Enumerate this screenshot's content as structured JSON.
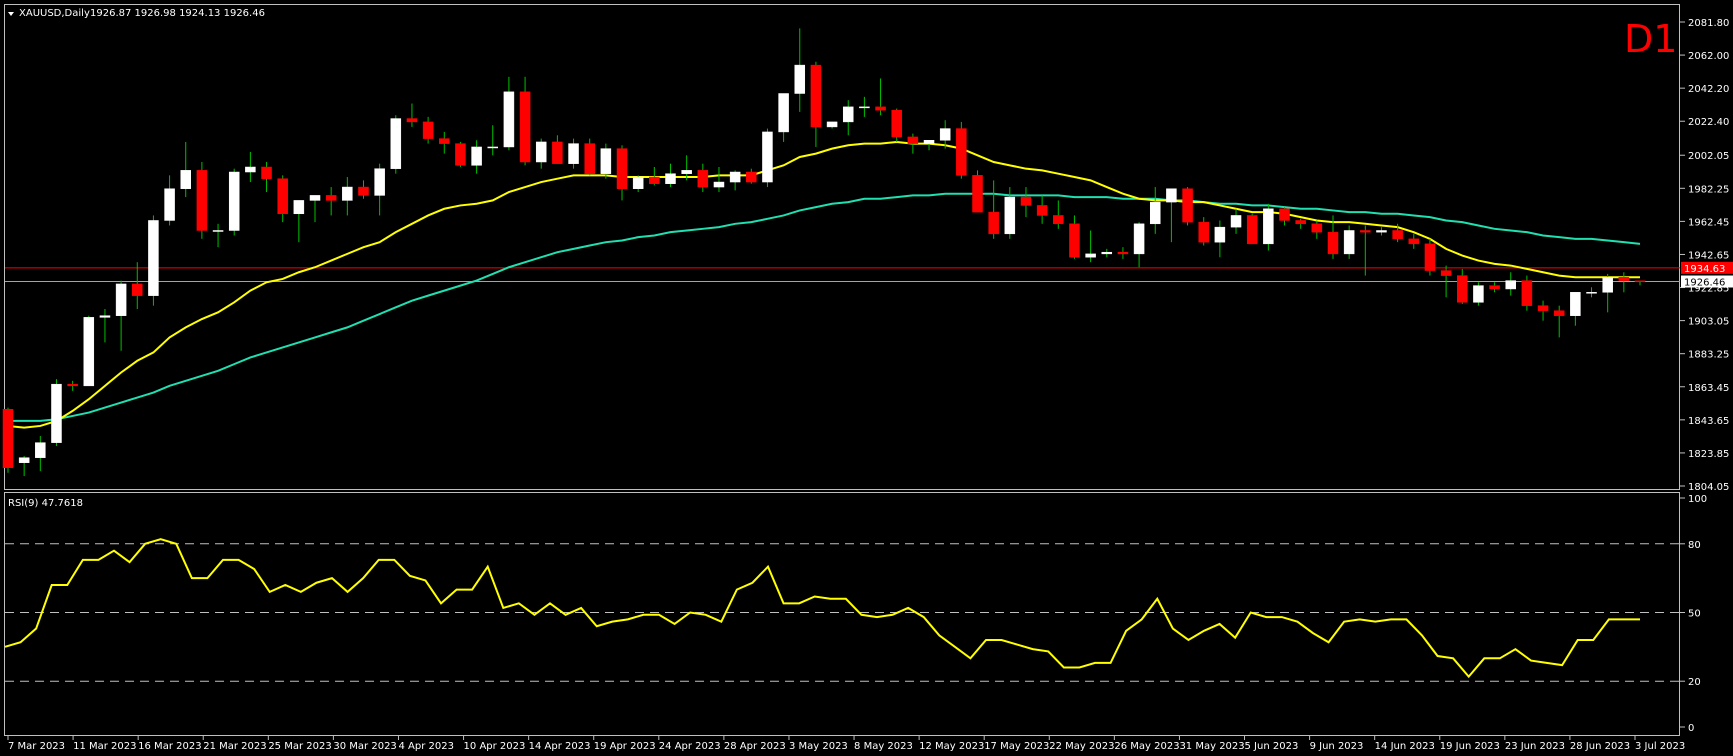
{
  "header": {
    "menu_icon": "triangle-down-icon",
    "symbol": "XAUUSD,Daily",
    "ohlc": "1926.87 1926.98 1924.13 1926.46",
    "timeframe_badge": "D1"
  },
  "rsi_panel": {
    "label": "RSI(9) 47.7618"
  },
  "price_tags": {
    "red_line_label": "1934.63",
    "current_label": "1926.46"
  },
  "colors": {
    "background": "#000000",
    "grid_border": "#c0c0c0",
    "bull_candle": "#ffffff",
    "bear_candle": "#ff0000",
    "wick": "#00c000",
    "ma_fast": "#ffff00",
    "ma_slow": "#20e0b0",
    "rsi_line": "#ffff00",
    "horizontal_line": "#ff0000",
    "badge_text": "#ff0000"
  },
  "chart_data": [
    {
      "type": "candlestick",
      "title": "XAUUSD,Daily",
      "y_ticks": [
        "2081.80",
        "2062.00",
        "2042.20",
        "2022.40",
        "2002.05",
        "1982.25",
        "1962.45",
        "1942.65",
        "1922.85",
        "1903.05",
        "1883.25",
        "1863.45",
        "1843.65",
        "1823.85",
        "1804.05"
      ],
      "ylim": [
        1804.05,
        2081.8
      ],
      "x_ticks": [
        "7 Mar 2023",
        "11 Mar 2023",
        "16 Mar 2023",
        "21 Mar 2023",
        "25 Mar 2023",
        "30 Mar 2023",
        "4 Apr 2023",
        "10 Apr 2023",
        "14 Apr 2023",
        "19 Apr 2023",
        "24 Apr 2023",
        "28 Apr 2023",
        "3 May 2023",
        "8 May 2023",
        "12 May 2023",
        "17 May 2023",
        "22 May 2023",
        "26 May 2023",
        "31 May 2023",
        "5 Jun 2023",
        "9 Jun 2023",
        "14 Jun 2023",
        "19 Jun 2023",
        "23 Jun 2023",
        "28 Jun 2023",
        "3 Jul 2023"
      ],
      "horizontal_line_value": 1934.63,
      "current_price": 1926.46,
      "candles": [
        {
          "o": 1850,
          "h": 1851,
          "l": 1812,
          "c": 1815
        },
        {
          "o": 1818,
          "h": 1822,
          "l": 1810,
          "c": 1821
        },
        {
          "o": 1821,
          "h": 1834,
          "l": 1813,
          "c": 1830
        },
        {
          "o": 1830,
          "h": 1868,
          "l": 1828,
          "c": 1865
        },
        {
          "o": 1865,
          "h": 1867,
          "l": 1861,
          "c": 1864
        },
        {
          "o": 1864,
          "h": 1906,
          "l": 1864,
          "c": 1905
        },
        {
          "o": 1905,
          "h": 1910,
          "l": 1890,
          "c": 1906
        },
        {
          "o": 1906,
          "h": 1927,
          "l": 1885,
          "c": 1925
        },
        {
          "o": 1925,
          "h": 1938,
          "l": 1910,
          "c": 1918
        },
        {
          "o": 1918,
          "h": 1966,
          "l": 1912,
          "c": 1963
        },
        {
          "o": 1963,
          "h": 1990,
          "l": 1960,
          "c": 1982
        },
        {
          "o": 1982,
          "h": 2010,
          "l": 1977,
          "c": 1993
        },
        {
          "o": 1993,
          "h": 1998,
          "l": 1952,
          "c": 1957
        },
        {
          "o": 1957,
          "h": 1961,
          "l": 1947,
          "c": 1957
        },
        {
          "o": 1957,
          "h": 1994,
          "l": 1954,
          "c": 1992
        },
        {
          "o": 1992,
          "h": 2004,
          "l": 1986,
          "c": 1995
        },
        {
          "o": 1995,
          "h": 1998,
          "l": 1980,
          "c": 1988
        },
        {
          "o": 1988,
          "h": 1990,
          "l": 1962,
          "c": 1967
        },
        {
          "o": 1967,
          "h": 1975,
          "l": 1950,
          "c": 1975
        },
        {
          "o": 1975,
          "h": 1978,
          "l": 1962,
          "c": 1978
        },
        {
          "o": 1978,
          "h": 1983,
          "l": 1966,
          "c": 1975
        },
        {
          "o": 1975,
          "h": 1989,
          "l": 1966,
          "c": 1983
        },
        {
          "o": 1983,
          "h": 1987,
          "l": 1976,
          "c": 1978
        },
        {
          "o": 1978,
          "h": 1997,
          "l": 1966,
          "c": 1994
        },
        {
          "o": 1994,
          "h": 2026,
          "l": 1991,
          "c": 2024
        },
        {
          "o": 2024,
          "h": 2033,
          "l": 2019,
          "c": 2022
        },
        {
          "o": 2022,
          "h": 2025,
          "l": 2009,
          "c": 2012
        },
        {
          "o": 2012,
          "h": 2016,
          "l": 2003,
          "c": 2009
        },
        {
          "o": 2009,
          "h": 2010,
          "l": 1995,
          "c": 1996
        },
        {
          "o": 1996,
          "h": 2011,
          "l": 1991,
          "c": 2007
        },
        {
          "o": 2007,
          "h": 2020,
          "l": 2002,
          "c": 2007
        },
        {
          "o": 2007,
          "h": 2049,
          "l": 2005,
          "c": 2040
        },
        {
          "o": 2040,
          "h": 2049,
          "l": 1996,
          "c": 1998
        },
        {
          "o": 1998,
          "h": 2012,
          "l": 1994,
          "c": 2010
        },
        {
          "o": 2010,
          "h": 2014,
          "l": 1997,
          "c": 1997
        },
        {
          "o": 1997,
          "h": 2012,
          "l": 1994,
          "c": 2009
        },
        {
          "o": 2009,
          "h": 2012,
          "l": 1990,
          "c": 1991
        },
        {
          "o": 1991,
          "h": 2009,
          "l": 1988,
          "c": 2006
        },
        {
          "o": 2006,
          "h": 2008,
          "l": 1975,
          "c": 1982
        },
        {
          "o": 1982,
          "h": 1990,
          "l": 1980,
          "c": 1989
        },
        {
          "o": 1989,
          "h": 1995,
          "l": 1984,
          "c": 1985
        },
        {
          "o": 1985,
          "h": 1997,
          "l": 1983,
          "c": 1991
        },
        {
          "o": 1991,
          "h": 2002,
          "l": 1987,
          "c": 1993
        },
        {
          "o": 1993,
          "h": 1997,
          "l": 1980,
          "c": 1983
        },
        {
          "o": 1983,
          "h": 1995,
          "l": 1980,
          "c": 1986
        },
        {
          "o": 1986,
          "h": 1993,
          "l": 1981,
          "c": 1992
        },
        {
          "o": 1992,
          "h": 1994,
          "l": 1985,
          "c": 1986
        },
        {
          "o": 1986,
          "h": 2018,
          "l": 1983,
          "c": 2016
        },
        {
          "o": 2016,
          "h": 2032,
          "l": 2010,
          "c": 2039
        },
        {
          "o": 2039,
          "h": 2078,
          "l": 2028,
          "c": 2056
        },
        {
          "o": 2056,
          "h": 2058,
          "l": 2007,
          "c": 2019
        },
        {
          "o": 2019,
          "h": 2022,
          "l": 2018,
          "c": 2022
        },
        {
          "o": 2022,
          "h": 2035,
          "l": 2014,
          "c": 2031
        },
        {
          "o": 2031,
          "h": 2037,
          "l": 2025,
          "c": 2031
        },
        {
          "o": 2031,
          "h": 2048,
          "l": 2026,
          "c": 2029
        },
        {
          "o": 2029,
          "h": 2030,
          "l": 2010,
          "c": 2013
        },
        {
          "o": 2013,
          "h": 2015,
          "l": 2003,
          "c": 2009
        },
        {
          "o": 2009,
          "h": 2011,
          "l": 2005,
          "c": 2011
        },
        {
          "o": 2011,
          "h": 2023,
          "l": 2006,
          "c": 2018
        },
        {
          "o": 2018,
          "h": 2022,
          "l": 1988,
          "c": 1990
        },
        {
          "o": 1990,
          "h": 1993,
          "l": 1976,
          "c": 1968
        },
        {
          "o": 1968,
          "h": 1987,
          "l": 1952,
          "c": 1955
        },
        {
          "o": 1955,
          "h": 1983,
          "l": 1952,
          "c": 1977
        },
        {
          "o": 1977,
          "h": 1983,
          "l": 1965,
          "c": 1972
        },
        {
          "o": 1972,
          "h": 1978,
          "l": 1961,
          "c": 1966
        },
        {
          "o": 1966,
          "h": 1975,
          "l": 1958,
          "c": 1961
        },
        {
          "o": 1961,
          "h": 1966,
          "l": 1940,
          "c": 1941
        },
        {
          "o": 1941,
          "h": 1957,
          "l": 1938,
          "c": 1943
        },
        {
          "o": 1943,
          "h": 1946,
          "l": 1941,
          "c": 1944
        },
        {
          "o": 1944,
          "h": 1947,
          "l": 1940,
          "c": 1943
        },
        {
          "o": 1943,
          "h": 1962,
          "l": 1935,
          "c": 1961
        },
        {
          "o": 1961,
          "h": 1983,
          "l": 1955,
          "c": 1974
        },
        {
          "o": 1974,
          "h": 1982,
          "l": 1950,
          "c": 1982
        },
        {
          "o": 1982,
          "h": 1983,
          "l": 1960,
          "c": 1962
        },
        {
          "o": 1962,
          "h": 1965,
          "l": 1948,
          "c": 1950
        },
        {
          "o": 1950,
          "h": 1963,
          "l": 1941,
          "c": 1959
        },
        {
          "o": 1959,
          "h": 1970,
          "l": 1955,
          "c": 1966
        },
        {
          "o": 1966,
          "h": 1967,
          "l": 1949,
          "c": 1949
        },
        {
          "o": 1949,
          "h": 1973,
          "l": 1945,
          "c": 1970
        },
        {
          "o": 1970,
          "h": 1971,
          "l": 1960,
          "c": 1963
        },
        {
          "o": 1963,
          "h": 1964,
          "l": 1958,
          "c": 1961
        },
        {
          "o": 1961,
          "h": 1963,
          "l": 1952,
          "c": 1956
        },
        {
          "o": 1956,
          "h": 1966,
          "l": 1940,
          "c": 1943
        },
        {
          "o": 1943,
          "h": 1960,
          "l": 1940,
          "c": 1957
        },
        {
          "o": 1957,
          "h": 1960,
          "l": 1930,
          "c": 1956
        },
        {
          "o": 1956,
          "h": 1959,
          "l": 1954,
          "c": 1957
        },
        {
          "o": 1957,
          "h": 1961,
          "l": 1950,
          "c": 1952
        },
        {
          "o": 1952,
          "h": 1955,
          "l": 1946,
          "c": 1949
        },
        {
          "o": 1949,
          "h": 1952,
          "l": 1930,
          "c": 1933
        },
        {
          "o": 1933,
          "h": 1936,
          "l": 1917,
          "c": 1930
        },
        {
          "o": 1930,
          "h": 1934,
          "l": 1913,
          "c": 1914
        },
        {
          "o": 1914,
          "h": 1926,
          "l": 1912,
          "c": 1924
        },
        {
          "o": 1924,
          "h": 1926,
          "l": 1920,
          "c": 1922
        },
        {
          "o": 1922,
          "h": 1932,
          "l": 1918,
          "c": 1927
        },
        {
          "o": 1927,
          "h": 1930,
          "l": 1909,
          "c": 1912
        },
        {
          "o": 1912,
          "h": 1915,
          "l": 1903,
          "c": 1909
        },
        {
          "o": 1909,
          "h": 1912,
          "l": 1893,
          "c": 1906
        },
        {
          "o": 1906,
          "h": 1920,
          "l": 1900,
          "c": 1920
        },
        {
          "o": 1920,
          "h": 1923,
          "l": 1917,
          "c": 1920
        },
        {
          "o": 1920,
          "h": 1931,
          "l": 1908,
          "c": 1929
        },
        {
          "o": 1929,
          "h": 1932,
          "l": 1920,
          "c": 1927
        },
        {
          "o": 1926.87,
          "h": 1926.98,
          "l": 1924.13,
          "c": 1926.46
        }
      ],
      "series": [
        {
          "values": [
            1840,
            1839,
            1840,
            1843,
            1849,
            1856,
            1864,
            1872,
            1879,
            1884,
            1893,
            1899,
            1904,
            1908,
            1914,
            1921,
            1926,
            1928,
            1932,
            1935,
            1939,
            1943,
            1947,
            1950,
            1956,
            1961,
            1966,
            1970,
            1972,
            1973,
            1975,
            1980,
            1983,
            1986,
            1988,
            1990,
            1990,
            1990,
            1989,
            1989,
            1989,
            1989,
            1989,
            1989,
            1990,
            1990,
            1990,
            1993,
            1996,
            2001,
            2003,
            2006,
            2008,
            2009,
            2009,
            2010,
            2009,
            2009,
            2008,
            2006,
            2002,
            1998,
            1996,
            1994,
            1993,
            1991,
            1989,
            1987,
            1983,
            1979,
            1976,
            1975,
            1975,
            1974,
            1974,
            1972,
            1970,
            1968,
            1968,
            1967,
            1965,
            1963,
            1962,
            1962,
            1961,
            1960,
            1959,
            1956,
            1952,
            1946,
            1942,
            1939,
            1937,
            1936,
            1934,
            1932,
            1930,
            1929,
            1929,
            1929,
            1929,
            1929
          ]
        },
        {
          "values": [
            1843,
            1843,
            1843,
            1844,
            1846,
            1848,
            1851,
            1854,
            1857,
            1860,
            1864,
            1867,
            1870,
            1873,
            1877,
            1881,
            1884,
            1887,
            1890,
            1893,
            1896,
            1899,
            1903,
            1907,
            1911,
            1915,
            1918,
            1921,
            1924,
            1927,
            1931,
            1935,
            1938,
            1941,
            1944,
            1946,
            1948,
            1950,
            1951,
            1953,
            1954,
            1956,
            1957,
            1958,
            1959,
            1961,
            1962,
            1964,
            1966,
            1969,
            1971,
            1973,
            1974,
            1976,
            1976,
            1977,
            1978,
            1978,
            1979,
            1979,
            1979,
            1979,
            1978,
            1978,
            1978,
            1978,
            1977,
            1977,
            1977,
            1976,
            1976,
            1976,
            1975,
            1975,
            1974,
            1973,
            1973,
            1972,
            1972,
            1971,
            1970,
            1970,
            1969,
            1968,
            1968,
            1967,
            1967,
            1966,
            1965,
            1963,
            1962,
            1960,
            1958,
            1957,
            1956,
            1954,
            1953,
            1952,
            1952,
            1951,
            1950,
            1949
          ]
        }
      ]
    },
    {
      "type": "line",
      "title": "RSI(9) 47.7618",
      "y_ticks": [
        "100",
        "80",
        "50",
        "20",
        "0"
      ],
      "ylim": [
        0,
        100
      ],
      "series": [
        {
          "values": [
            35,
            37,
            43,
            62,
            62,
            73,
            73,
            77,
            72,
            80,
            82,
            80,
            65,
            65,
            73,
            73,
            69,
            59,
            62,
            59,
            63,
            65,
            59,
            65,
            73,
            73,
            66,
            64,
            54,
            60,
            60,
            70,
            52,
            54,
            49,
            54,
            49,
            52,
            44,
            46,
            47,
            49,
            49,
            45,
            50,
            49,
            46,
            60,
            63,
            70,
            54,
            54,
            57,
            56,
            56,
            49,
            48,
            49,
            52,
            48,
            40,
            35,
            30,
            38,
            38,
            36,
            34,
            33,
            26,
            26,
            28,
            28,
            42,
            47,
            56,
            43,
            38,
            42,
            45,
            39,
            50,
            48,
            48,
            46,
            41,
            37,
            46,
            47,
            46,
            47,
            47,
            40,
            31,
            30,
            22,
            30,
            30,
            34,
            29,
            28,
            27,
            38,
            38,
            47,
            47,
            47
          ]
        }
      ]
    }
  ]
}
